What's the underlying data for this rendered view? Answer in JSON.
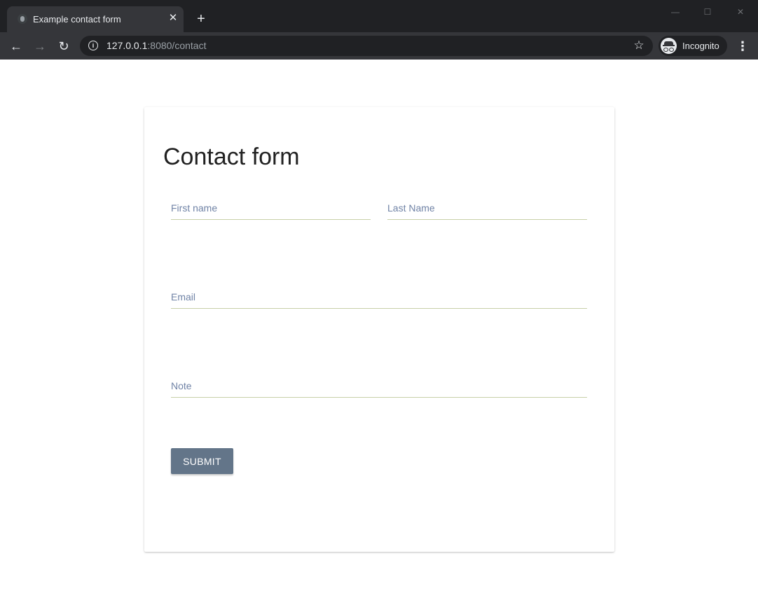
{
  "browser": {
    "tab": {
      "title": "Example contact form",
      "close_glyph": "✕",
      "favicon": "page-favicon-icon"
    },
    "new_tab_glyph": "+",
    "window_controls": {
      "minimize": "—",
      "maximize": "☐",
      "close": "✕"
    },
    "nav": {
      "back": "←",
      "forward": "→",
      "reload": "↻"
    },
    "address": {
      "host": "127.0.0.1",
      "rest": ":8080/contact"
    },
    "bookmark_glyph": "☆",
    "incognito_label": "Incognito",
    "menu_glyph": "⋮",
    "colors": {
      "titlebar": "#202124",
      "toolbar": "#35363a"
    }
  },
  "form": {
    "title": "Contact form",
    "first_name_placeholder": "First name",
    "last_name_placeholder": "Last Name",
    "email_placeholder": "Email",
    "note_placeholder": "Note",
    "submit_label": "SUBMIT",
    "colors": {
      "button": "#637589",
      "field_underline": "#c8d0a8",
      "placeholder": "#7083a6"
    }
  }
}
